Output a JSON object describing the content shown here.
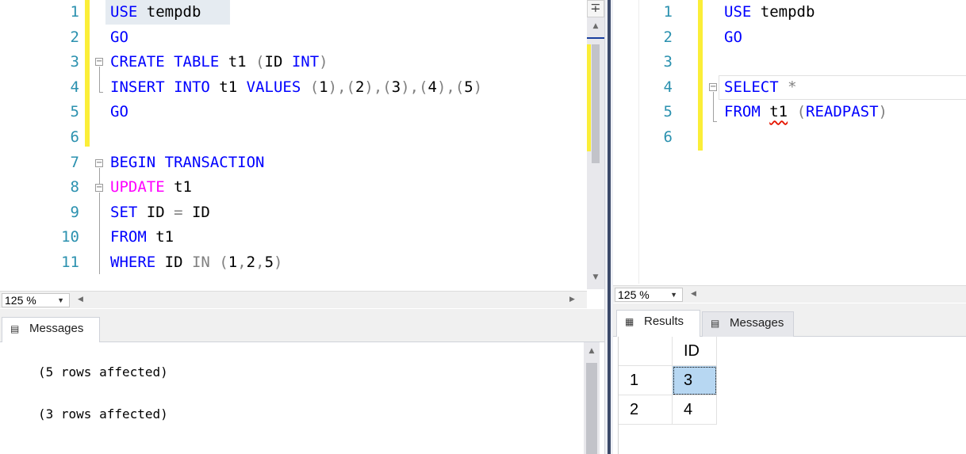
{
  "left_editor": {
    "lines": [
      {
        "num": "1",
        "tokens": [
          {
            "t": "USE",
            "c": "kw"
          },
          {
            "t": " tempdb",
            "c": "id"
          }
        ]
      },
      {
        "num": "2",
        "tokens": [
          {
            "t": "GO",
            "c": "kw"
          }
        ]
      },
      {
        "num": "3",
        "tokens": [
          {
            "t": "CREATE",
            "c": "kw"
          },
          {
            "t": " ",
            "c": "id"
          },
          {
            "t": "TABLE",
            "c": "kw"
          },
          {
            "t": " t1 ",
            "c": "id"
          },
          {
            "t": "(",
            "c": "op"
          },
          {
            "t": "ID ",
            "c": "id"
          },
          {
            "t": "INT",
            "c": "kw"
          },
          {
            "t": ")",
            "c": "op"
          }
        ]
      },
      {
        "num": "4",
        "tokens": [
          {
            "t": "INSERT",
            "c": "kw"
          },
          {
            "t": " ",
            "c": "id"
          },
          {
            "t": "INTO",
            "c": "kw"
          },
          {
            "t": " t1 ",
            "c": "id"
          },
          {
            "t": "VALUES",
            "c": "kw"
          },
          {
            "t": " ",
            "c": "id"
          },
          {
            "t": "(",
            "c": "op"
          },
          {
            "t": "1",
            "c": "id"
          },
          {
            "t": "),(",
            "c": "op"
          },
          {
            "t": "2",
            "c": "id"
          },
          {
            "t": "),(",
            "c": "op"
          },
          {
            "t": "3",
            "c": "id"
          },
          {
            "t": "),(",
            "c": "op"
          },
          {
            "t": "4",
            "c": "id"
          },
          {
            "t": "),(",
            "c": "op"
          },
          {
            "t": "5",
            "c": "id"
          },
          {
            "t": ")",
            "c": "op"
          }
        ]
      },
      {
        "num": "5",
        "tokens": [
          {
            "t": "GO",
            "c": "kw"
          }
        ]
      },
      {
        "num": "6",
        "tokens": []
      },
      {
        "num": "7",
        "tokens": [
          {
            "t": "BEGIN",
            "c": "kw"
          },
          {
            "t": " ",
            "c": "id"
          },
          {
            "t": "TRANSACTION",
            "c": "kw"
          }
        ]
      },
      {
        "num": "8",
        "tokens": [
          {
            "t": "UPDATE",
            "c": "fn"
          },
          {
            "t": " t1",
            "c": "id"
          }
        ]
      },
      {
        "num": "9",
        "tokens": [
          {
            "t": "SET",
            "c": "kw"
          },
          {
            "t": " ID ",
            "c": "id"
          },
          {
            "t": "=",
            "c": "op"
          },
          {
            "t": " ID",
            "c": "id"
          }
        ]
      },
      {
        "num": "10",
        "tokens": [
          {
            "t": "FROM",
            "c": "kw"
          },
          {
            "t": " t1",
            "c": "id"
          }
        ]
      },
      {
        "num": "11",
        "tokens": [
          {
            "t": "WHERE",
            "c": "kw"
          },
          {
            "t": " ID ",
            "c": "id"
          },
          {
            "t": "IN",
            "c": "op"
          },
          {
            "t": " ",
            "c": "id"
          },
          {
            "t": "(",
            "c": "op"
          },
          {
            "t": "1",
            "c": "id"
          },
          {
            "t": ",",
            "c": "op"
          },
          {
            "t": "2",
            "c": "id"
          },
          {
            "t": ",",
            "c": "op"
          },
          {
            "t": "5",
            "c": "id"
          },
          {
            "t": ")",
            "c": "op"
          }
        ]
      }
    ]
  },
  "right_editor": {
    "lines": [
      {
        "num": "1",
        "tokens": [
          {
            "t": "USE",
            "c": "kw"
          },
          {
            "t": " tempdb",
            "c": "id"
          }
        ]
      },
      {
        "num": "2",
        "tokens": [
          {
            "t": "GO",
            "c": "kw"
          }
        ]
      },
      {
        "num": "3",
        "tokens": []
      },
      {
        "num": "4",
        "tokens": [
          {
            "t": "SELECT",
            "c": "kw"
          },
          {
            "t": " ",
            "c": "id"
          },
          {
            "t": "*",
            "c": "op"
          }
        ]
      },
      {
        "num": "5",
        "tokens": [
          {
            "t": "FROM",
            "c": "kw"
          },
          {
            "t": " ",
            "c": "id"
          },
          {
            "t": "t1",
            "c": "id squiggle"
          },
          {
            "t": " ",
            "c": "id"
          },
          {
            "t": "(",
            "c": "op"
          },
          {
            "t": "READPAST",
            "c": "kw"
          },
          {
            "t": ")",
            "c": "op"
          }
        ]
      },
      {
        "num": "6",
        "tokens": []
      }
    ]
  },
  "left_zoom": "125 %",
  "right_zoom": "125 %",
  "left_results": {
    "tabs": [
      {
        "label": "Messages",
        "icon": "messages-icon"
      }
    ],
    "messages": [
      "(5 rows affected)",
      "(3 rows affected)"
    ]
  },
  "right_results": {
    "tabs": [
      {
        "label": "Results",
        "icon": "grid-icon"
      },
      {
        "label": "Messages",
        "icon": "messages-icon"
      }
    ],
    "grid": {
      "columns": [
        "ID"
      ],
      "rows": [
        {
          "num": "1",
          "values": [
            "3"
          ]
        },
        {
          "num": "2",
          "values": [
            "4"
          ]
        }
      ]
    }
  },
  "colors": {
    "keyword": "#0000ff",
    "function": "#ff00ff",
    "operator": "#808080",
    "line_number": "#2b91af",
    "change_bar": "#fbee38"
  }
}
